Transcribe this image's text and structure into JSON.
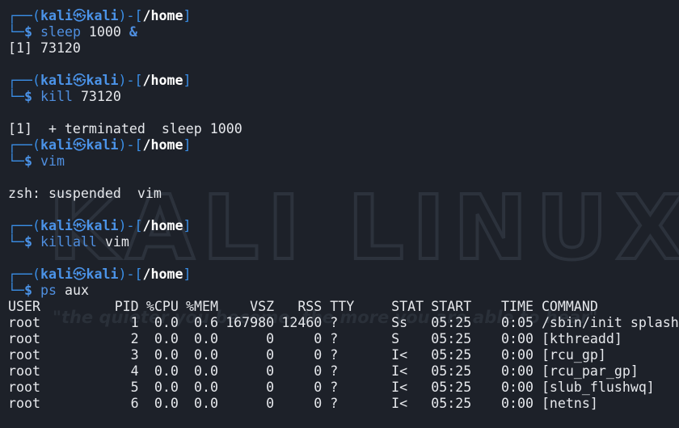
{
  "prompt": {
    "open": "┌──(",
    "user": "kali",
    "skull": "㉿",
    "host": "kali",
    "close": ")-[",
    "path": "/home",
    "end": "]",
    "corner": "└─",
    "dollar": "$"
  },
  "session": [
    {
      "cmd": "sleep",
      "args": " 1000 ",
      "amp": "&",
      "output": [
        "[1] 73120",
        ""
      ]
    },
    {
      "cmd": "kill",
      "args": " 73120",
      "amp": "",
      "output": [
        "",
        "[1]  + terminated  sleep 1000"
      ]
    },
    {
      "cmd": "vim",
      "args": "",
      "amp": "",
      "output": [
        "",
        "zsh: suspended  vim",
        ""
      ]
    },
    {
      "cmd": "killall",
      "args": " vim",
      "amp": "",
      "output": [
        ""
      ]
    },
    {
      "cmd": "ps",
      "args": " aux",
      "amp": "",
      "output": []
    }
  ],
  "ps": {
    "headers": [
      "USER",
      "PID",
      "%CPU",
      "%MEM",
      "VSZ",
      "RSS",
      "TTY",
      "STAT",
      "START",
      "TIME",
      "COMMAND"
    ],
    "rows": [
      [
        "root",
        "1",
        "0.0",
        "0.6",
        "167980",
        "12460",
        "?",
        "Ss",
        "05:25",
        "0:05",
        "/sbin/init splash"
      ],
      [
        "root",
        "2",
        "0.0",
        "0.0",
        "0",
        "0",
        "?",
        "S",
        "05:25",
        "0:00",
        "[kthreadd]"
      ],
      [
        "root",
        "3",
        "0.0",
        "0.0",
        "0",
        "0",
        "?",
        "I<",
        "05:25",
        "0:00",
        "[rcu_gp]"
      ],
      [
        "root",
        "4",
        "0.0",
        "0.0",
        "0",
        "0",
        "?",
        "I<",
        "05:25",
        "0:00",
        "[rcu_par_gp]"
      ],
      [
        "root",
        "5",
        "0.0",
        "0.0",
        "0",
        "0",
        "?",
        "I<",
        "05:25",
        "0:00",
        "[slub_flushwq]"
      ],
      [
        "root",
        "6",
        "0.0",
        "0.0",
        "0",
        "0",
        "?",
        "I<",
        "05:25",
        "0:00",
        "[netns]"
      ]
    ]
  },
  "wallpaper": {
    "logo_text": "KALI LINUX",
    "tagline": "\"the quieter you become, the more you are able to hear\""
  },
  "colors": {
    "background": "#1d2129",
    "prompt_blue": "#3a8ee6",
    "text": "#e6e8ec"
  }
}
